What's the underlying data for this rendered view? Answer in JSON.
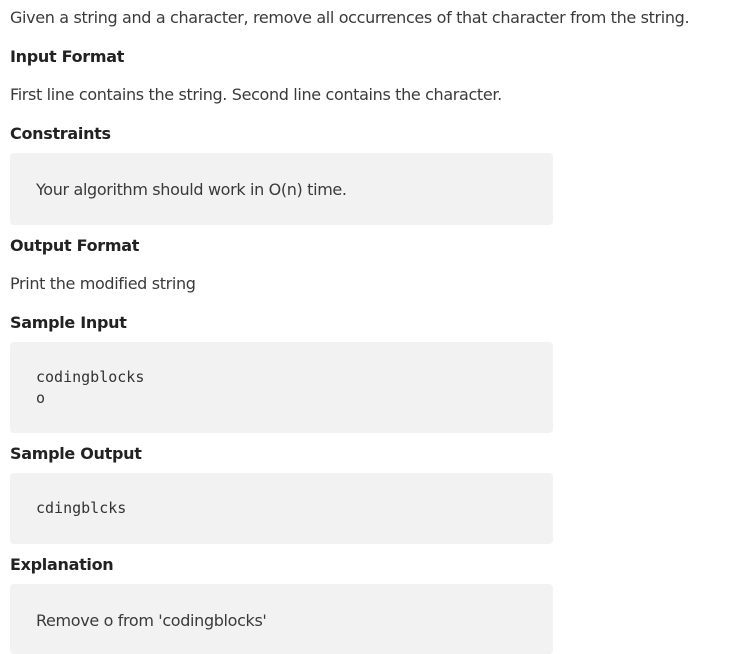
{
  "problem": {
    "statement": "Given a string and a character, remove all occurrences of that character from the string."
  },
  "sections": {
    "input_format": {
      "heading": "Input Format",
      "text": "First line contains the string. Second line contains the character."
    },
    "constraints": {
      "heading": "Constraints",
      "text": "Your algorithm should work in O(n) time."
    },
    "output_format": {
      "heading": "Output Format",
      "text": "Print the modified string"
    },
    "sample_input": {
      "heading": "Sample Input",
      "lines": [
        "codingblocks",
        "o"
      ]
    },
    "sample_output": {
      "heading": "Sample Output",
      "lines": [
        "cdingblcks"
      ]
    },
    "explanation": {
      "heading": "Explanation",
      "text": "Remove o from 'codingblocks'"
    }
  }
}
